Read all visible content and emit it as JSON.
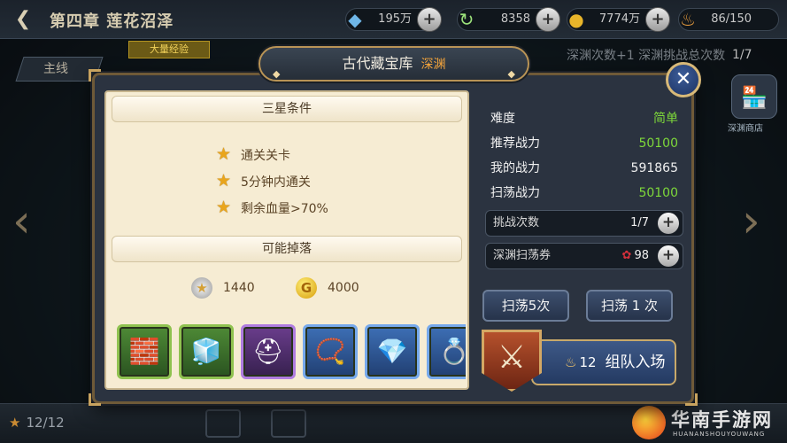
{
  "topbar": {
    "back_icon": "back-arrow-icon",
    "chapter_title": "第四章 莲花沼泽",
    "resources": [
      {
        "icon": "gem-icon",
        "value": "195万"
      },
      {
        "icon": "refresh-icon",
        "value": "8358"
      },
      {
        "icon": "gold-coin-icon",
        "value": "7774万"
      },
      {
        "icon": "stamina-flame-icon",
        "value": "86/150"
      }
    ]
  },
  "background": {
    "mainline_tab": "主线",
    "reward_tag": "大量经验",
    "right_header": "深渊次数+1   深渊挑战总次数",
    "right_header_value": "1/7",
    "shop_label": "深渊商店",
    "star_count": "12/12"
  },
  "dialog": {
    "title": "古代藏宝库",
    "title_tag": "深渊",
    "close_icon": "close-icon",
    "three_star": {
      "header": "三星条件",
      "conditions": [
        "通关关卡",
        "5分钟内通关",
        "剩余血量>70%"
      ]
    },
    "drops": {
      "header": "可能掉落",
      "star_value": "1440",
      "gold_value": "4000",
      "items": [
        {
          "icon": "red-armor-block-icon",
          "rarity": "green"
        },
        {
          "icon": "blue-armor-block-icon",
          "rarity": "green"
        },
        {
          "icon": "purple-helmet-icon",
          "rarity": "purple"
        },
        {
          "icon": "gold-necklace-icon",
          "rarity": "blue"
        },
        {
          "icon": "gold-earrings-icon",
          "rarity": "blue"
        },
        {
          "icon": "gold-ring-icon",
          "rarity": "blue"
        }
      ]
    },
    "stats": [
      {
        "label": "难度",
        "value": "简单",
        "color": "#7ed83a"
      },
      {
        "label": "推荐战力",
        "value": "50100",
        "color": "#7ed83a"
      },
      {
        "label": "我的战力",
        "value": "591865",
        "color": "#f0f0f0"
      },
      {
        "label": "扫荡战力",
        "value": "50100",
        "color": "#7ed83a"
      }
    ],
    "challenge_count": {
      "label": "挑战次数",
      "value": "1/7"
    },
    "sweep_ticket": {
      "label": "深渊扫荡券",
      "value": "98"
    },
    "sweep5_label": "扫荡5次",
    "sweep1_label": "扫荡 1 次",
    "team_button": {
      "count": "12",
      "label": "组队入场"
    }
  },
  "watermark": {
    "text": "华南手游网",
    "sub": "HUANANSHOUYOUWANG"
  }
}
